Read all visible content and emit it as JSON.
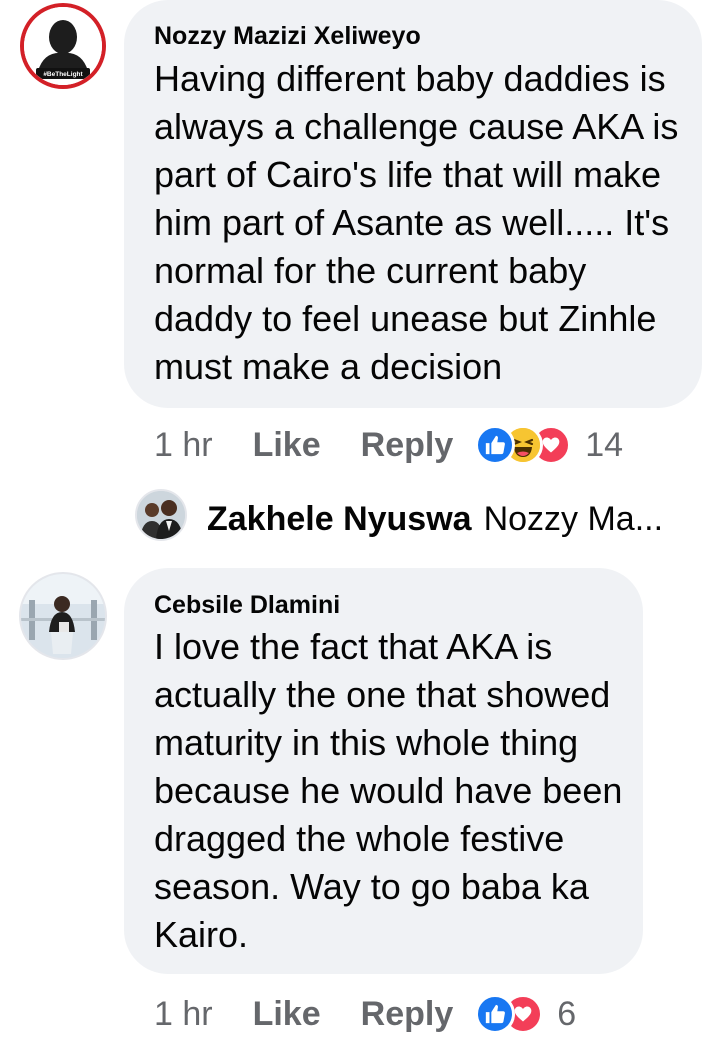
{
  "comments": [
    {
      "author": "Nozzy Mazizi Xeliweyo",
      "avatar_badge": "#BeTheLight",
      "text": "Having different baby daddies is\nalways a challenge cause AKA is\npart of Cairo's life that will make\nhim part of Asante as well..... It's\nnormal for the current baby\ndaddy to feel unease but Zinhle\nmust make a decision",
      "time": "1 hr",
      "like_label": "Like",
      "reply_label": "Reply",
      "reactions": [
        "like-icon",
        "haha-icon",
        "love-icon"
      ],
      "reaction_count": "14",
      "reply_preview": {
        "author": "Zakhele Nyuswa",
        "text": "Nozzy Ma..."
      }
    },
    {
      "author": "Cebsile Dlamini",
      "text": "I love the fact that AKA is\nactually the one that showed\nmaturity in this whole thing\nbecause he would have been\ndragged the whole festive\nseason.  Way to go baba ka\nKairo.",
      "time": "1 hr",
      "like_label": "Like",
      "reply_label": "Reply",
      "reactions": [
        "like-icon",
        "love-icon"
      ],
      "reaction_count": "6"
    }
  ],
  "colors": {
    "bubble": "#f0f2f5",
    "meta_text": "#65676b",
    "like_blue": "#1877f2",
    "love_red": "#f33e58",
    "haha_yellow": "#f7b125",
    "avatar_ring": "#e41e26"
  }
}
